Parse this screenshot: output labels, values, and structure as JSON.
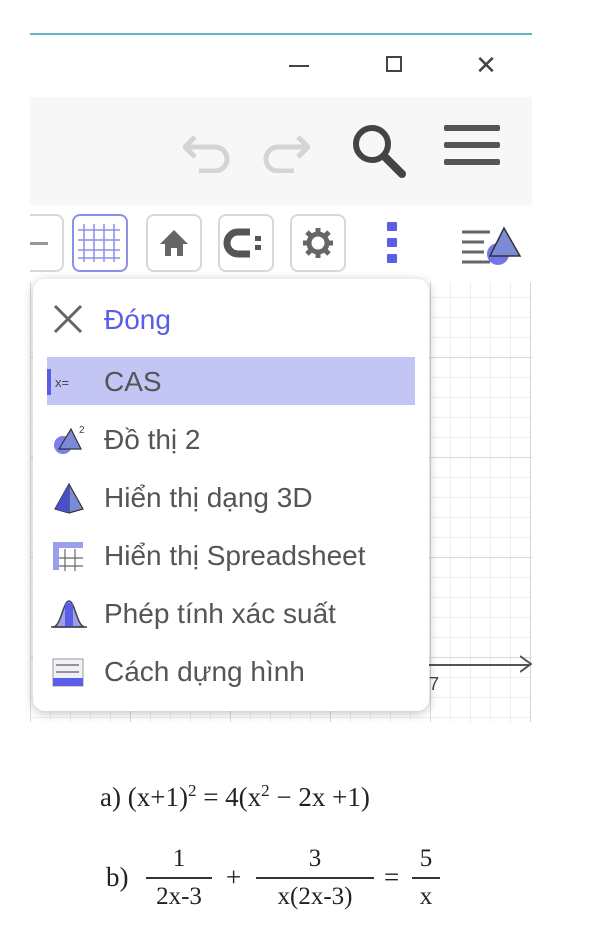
{
  "window": {
    "minimize_icon": "minimize-icon",
    "maximize_icon": "maximize-icon",
    "close_glyph": "✕"
  },
  "toolbar": {
    "undo_icon": "undo-icon",
    "redo_icon": "redo-icon",
    "search_icon": "search-icon",
    "menu_icon": "hamburger-menu-icon"
  },
  "graphics_bar": {
    "buttons": [
      "axes-icon",
      "grid-icon",
      "home-icon",
      "camera-icon",
      "gear-icon",
      "kebab-icon",
      "style-bar-icon"
    ]
  },
  "view_menu": {
    "items": [
      {
        "label": "Đóng",
        "icon": "close-icon"
      },
      {
        "label": "CAS",
        "icon": "cas-icon"
      },
      {
        "label": "Đồ thị 2",
        "icon": "graphics2-icon"
      },
      {
        "label": "Hiển thị dạng 3D",
        "icon": "3d-view-icon"
      },
      {
        "label": "Hiển thị Spreadsheet",
        "icon": "spreadsheet-icon"
      },
      {
        "label": "Phép tính xác suất",
        "icon": "probability-icon"
      },
      {
        "label": "Cách dựng hình",
        "icon": "construction-protocol-icon"
      }
    ],
    "selected": "CAS"
  },
  "axis": {
    "tick_label": "7"
  },
  "equations": {
    "a": {
      "label": "a)",
      "lhs_base": "(x+1)",
      "lhs_exp": "2",
      "rhs_prefix": " = 4(x",
      "rhs_exp": "2",
      "rhs_suffix": " − 2x +1)"
    },
    "b": {
      "label": "b)",
      "frac1_num": "1",
      "frac1_den": "2x-3",
      "plus": "+",
      "frac2_num": "3",
      "frac2_den": "x(2x-3)",
      "equals": "=",
      "frac3_num": "5",
      "frac3_den": "x"
    }
  },
  "colors": {
    "accent": "#5a5ee6",
    "selected_bg": "#c3c5f5",
    "top_line": "#5fb7c6"
  }
}
